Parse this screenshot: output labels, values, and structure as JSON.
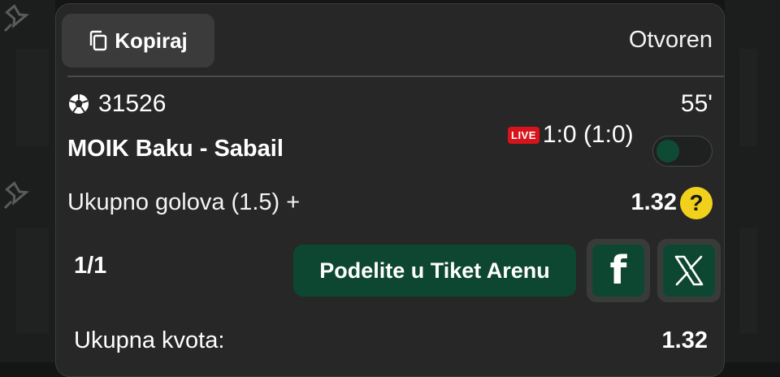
{
  "header": {
    "copy_label": "Kopiraj",
    "status": "Otvoren"
  },
  "event": {
    "id": "31526",
    "minute": "55'",
    "teams": "MOIK Baku - Sabail",
    "live_badge": "LIVE",
    "score": "1:0 (1:0)",
    "toggle_on": false
  },
  "selection": {
    "market": "Ukupno golova (1.5) +",
    "odd": "1.32",
    "help": "?"
  },
  "footer": {
    "count": "1/1",
    "share_label": "Podelite u Tiket Arenu",
    "facebook_glyph": "f",
    "total_label": "Ukupna kvota:",
    "total_value": "1.32"
  },
  "colors": {
    "accent_green": "#0d4731",
    "live_red": "#d8131c",
    "help_yellow": "#f2d11d",
    "card_bg": "#262726"
  },
  "icons": [
    "pin-icon",
    "copy-icon",
    "soccer-ball-icon",
    "question-icon",
    "facebook-icon",
    "x-logo-icon"
  ]
}
